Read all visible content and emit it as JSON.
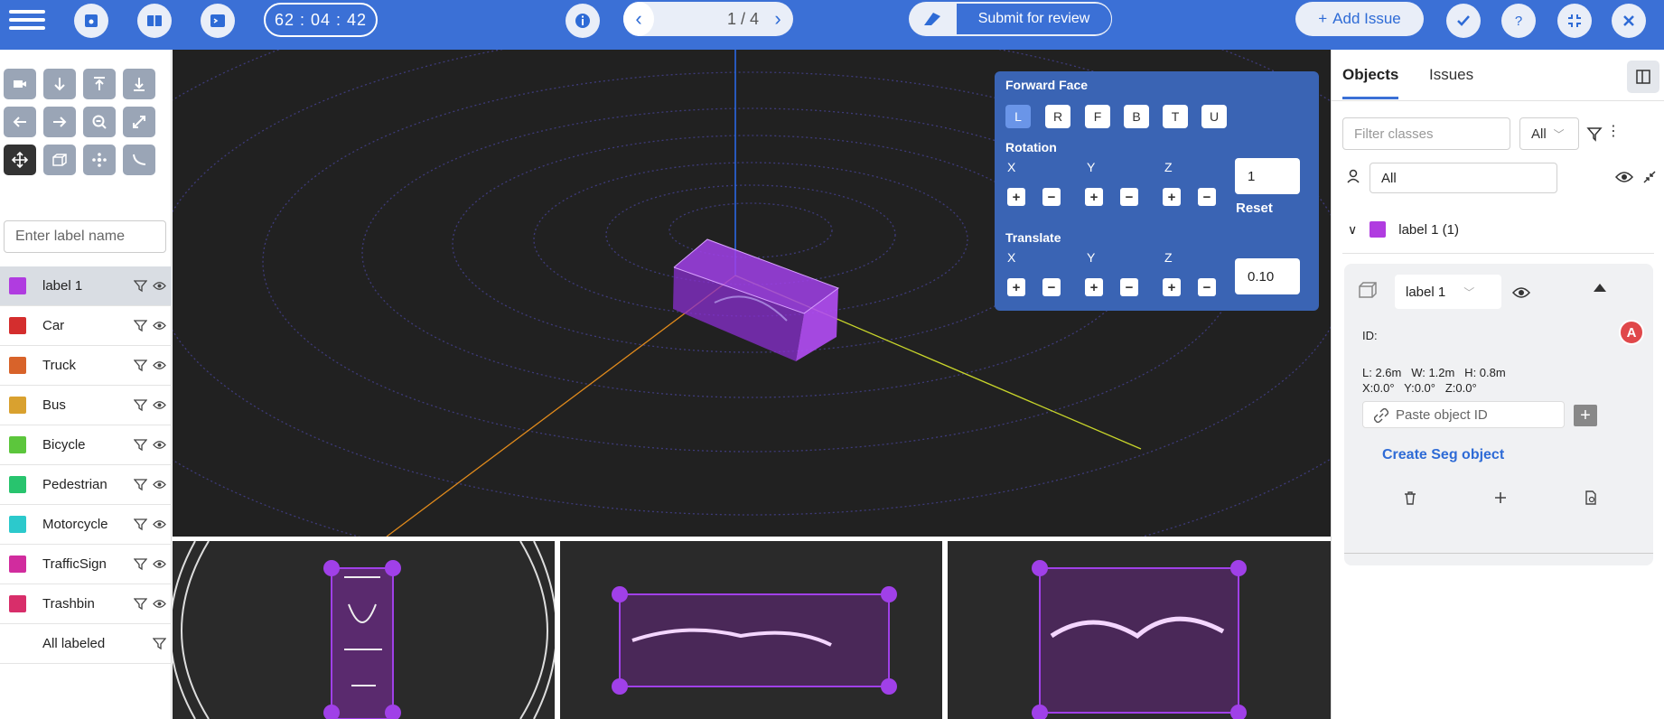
{
  "topbar": {
    "timer": "62 : 04 : 42",
    "page_indicator": "1 / 4",
    "submit_label": "Submit for review",
    "add_issue_label": "Add Issue"
  },
  "left": {
    "label_placeholder": "Enter label name",
    "classes": [
      {
        "name": "label 1",
        "color": "#b03ce0"
      },
      {
        "name": "Car",
        "color": "#d42e2e"
      },
      {
        "name": "Truck",
        "color": "#d8632a"
      },
      {
        "name": "Bus",
        "color": "#d9a12f"
      },
      {
        "name": "Bicycle",
        "color": "#5cc63c"
      },
      {
        "name": "Pedestrian",
        "color": "#28c46e"
      },
      {
        "name": "Motorcycle",
        "color": "#2cc9cc"
      },
      {
        "name": "TrafficSign",
        "color": "#d12c9e"
      },
      {
        "name": "Trashbin",
        "color": "#d82e6a"
      },
      {
        "name": "All labeled",
        "color": ""
      }
    ]
  },
  "forward_face": {
    "title": "Forward Face",
    "faces": [
      "L",
      "R",
      "F",
      "B",
      "T",
      "U"
    ],
    "rotation_title": "Rotation",
    "translate_title": "Translate",
    "axes": [
      "X",
      "Y",
      "Z"
    ],
    "rotation_value": "1",
    "translate_value": "0.10",
    "reset_label": "Reset"
  },
  "right": {
    "tabs": [
      "Objects",
      "Issues"
    ],
    "filter_placeholder": "Filter classes",
    "filter_select": "All",
    "user_filter": "All",
    "group_label": "label 1 (1)",
    "object": {
      "class_select": "label 1",
      "id_label": "ID:",
      "avatar": "A",
      "dims": "L: 2.6m   W: 1.2m   H: 0.8m",
      "rot": "X:0.0°   Y:0.0°   Z:0.0°",
      "paste_placeholder": "Paste object ID",
      "create_seg": "Create Seg object"
    }
  },
  "colors": {
    "accent": "#3b70d6",
    "box": "#a040e8",
    "viewport_bg": "#212121"
  }
}
